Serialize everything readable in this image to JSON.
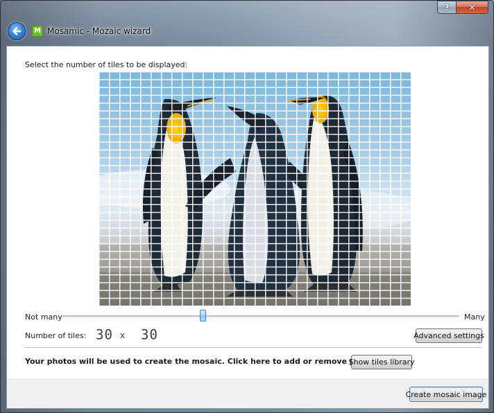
{
  "window": {
    "title": "Mosamic - Mozaic wizard",
    "app_icon_letter": "M",
    "help_glyph": "?",
    "close_glyph": "✕"
  },
  "wizard": {
    "prompt": "Select the number of tiles to be displayed:",
    "slider": {
      "min_label": "Not many",
      "max_label": "Many",
      "value_fraction": 0.355
    },
    "tiles": {
      "label": "Number of tiles:",
      "columns": "30",
      "times": "x",
      "rows": "30"
    },
    "advanced_button": "Advanced settings",
    "photos_prompt": "Your photos will be used to create the mosaic. Click here to add or remove photos:",
    "tiles_library_button": "Show tiles library",
    "create_button": "Create mosaic image"
  },
  "colors": {
    "accent": "#3c7fb1",
    "slider_thumb": "#86bfee",
    "close_button": "#c0442b"
  }
}
